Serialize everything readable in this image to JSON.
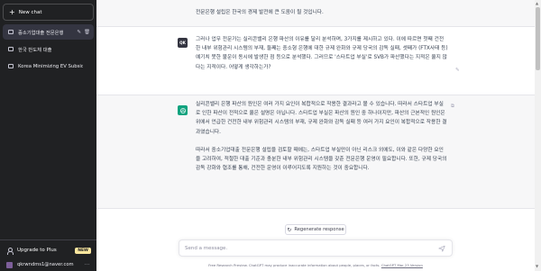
{
  "sidebar": {
    "new_chat_label": "New chat",
    "conversations": [
      {
        "label": "중소기업대출 전문은행",
        "active": true
      },
      {
        "label": "한국 반도체 대출",
        "active": false
      },
      {
        "label": "Korea Minimizing EV Subsidy",
        "active": false
      }
    ],
    "upgrade_label": "Upgrade to Plus",
    "new_badge": "NEW",
    "account_email": "qkrwndms1@naver.com",
    "account_menu": "···"
  },
  "chat": {
    "prev_assistant_tail": "전문은행 설립은 한국의 경제 발전에 큰 도움이 될 것입니다.",
    "user_avatar": "QK",
    "user_message": "그러나 업무 전문가는 실리콘밸리 은행 파산의 이유를 달리 분석하며, 3가지를 제시하고 있다. 이에 따르면 첫째 건전한 내부 위험관리 시스템의 부재, 둘째는 중소형 은행에 대한 규제 완화와 규제 당국의 감독 실패, 셋째가 (FTX사태 등) 예기치 못한 불운이 동시에 발생한 점 등으로 분석했다. 그러므로 '스타트업 부실'로 SVB가 파산했다는 지적은 옳지 않다는 지적이다. 어떻게 생각하는가?",
    "assistant_paragraphs": [
      "실리콘밸리 은행 파산의 원인은 여러 가지 요인이 복합적으로 작용한 결과라고 볼 수 있습니다. 따라서 스타트업 부실로 인한 파산이 전적으로 옳은 설명은 아닙니다. 스타트업 부실은 파산의 원인 중 하나이지만, 파산의 근본적인 원인은 위에서 언급한 건전한 내부 위험관리 시스템의 부재, 규제 완화와 감독 실패 등 여러 가지 요인이 복합적으로 작용한 결과였습니다.",
      "따라서 중소기업대출 전문은행 설립을 검토할 때에는, 스타트업 부실만이 아닌 리스크 외에도, 이와 같은 다양한 요인을 고려하여, 적절한 대출 기준과 충분한 내부 위험관리 시스템을 갖춘 전문은행 운영이 필요합니다. 또한, 규제 당국의 감독 강화와 협조를 통해, 건전한 운영이 이루어지도록 지원하는 것이 중요합니다."
    ],
    "user_actions_icon": "edit-icon",
    "assistant_actions_icon": "copy-thumbs-icons"
  },
  "composer": {
    "regenerate_label": "Regenerate response",
    "placeholder": "Send a message.",
    "footer_text": "Free Research Preview. ChatGPT may produce inaccurate information about people, places, or facts.",
    "footer_link": "ChatGPT Mar 23 Version"
  },
  "colors": {
    "sidebar_bg": "#202123",
    "assistant_bg": "#f7f7f8",
    "gpt_green": "#10a37f",
    "badge": "#fae69e"
  }
}
